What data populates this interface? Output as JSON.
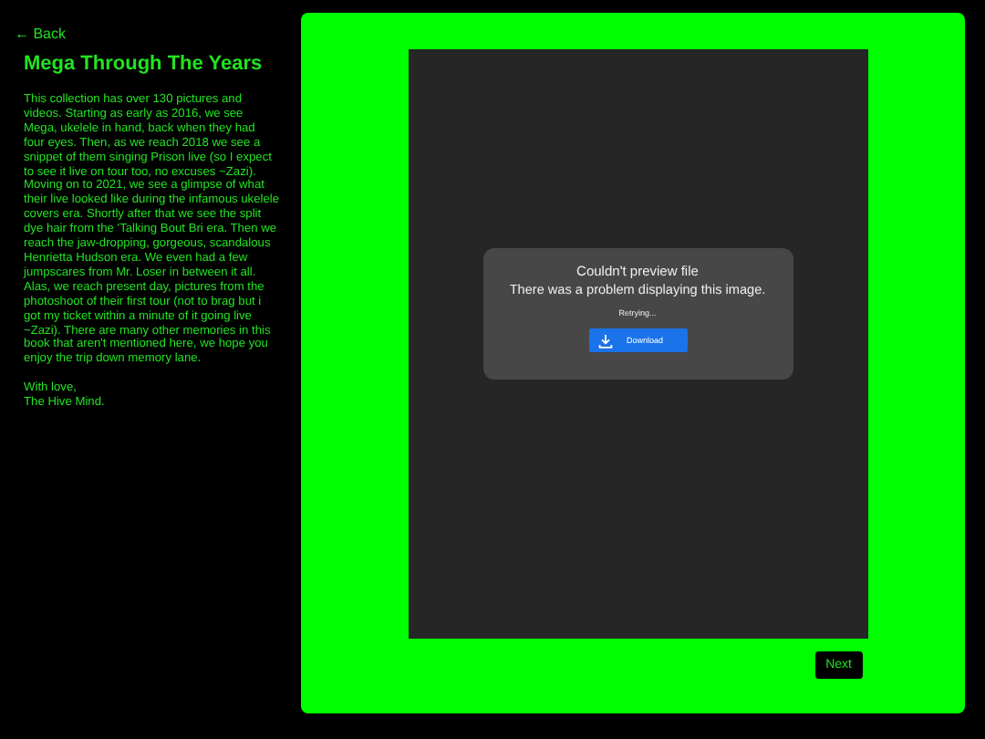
{
  "back_link": "← Back",
  "title": "Mega Through The Years",
  "description": "This collection has over 130 pictures and videos. Starting as early as 2016, we see Mega, ukelele in hand, back when they had four eyes. Then, as we reach 2018 we see a snippet of them singing Prison live (so I expect to see it live on tour too, no excuses ~Zazi). Moving on to 2021, we see a glimpse of what their live looked like during the infamous ukelele covers era. Shortly after that we see the split dye hair from the 'Talking Bout Bri era. Then we reach the jaw-dropping, gorgeous, scandalous Henrietta Hudson era. We even had a few jumpscares from Mr. Loser in between it all. Alas, we reach present day, pictures from the photoshoot of their first tour (not to brag but i got my ticket within a minute of it going live ~Zazi). There are many other memories in this book that aren't mentioned here, we hope you enjoy the trip down memory lane.",
  "signoff": [
    "With love,",
    "The Hive Mind."
  ],
  "preview": {
    "heading": "Couldn't preview file",
    "message": "There was a problem displaying this image.",
    "status": "Retrying...",
    "download_button": "Download"
  },
  "next_button": "Next"
}
